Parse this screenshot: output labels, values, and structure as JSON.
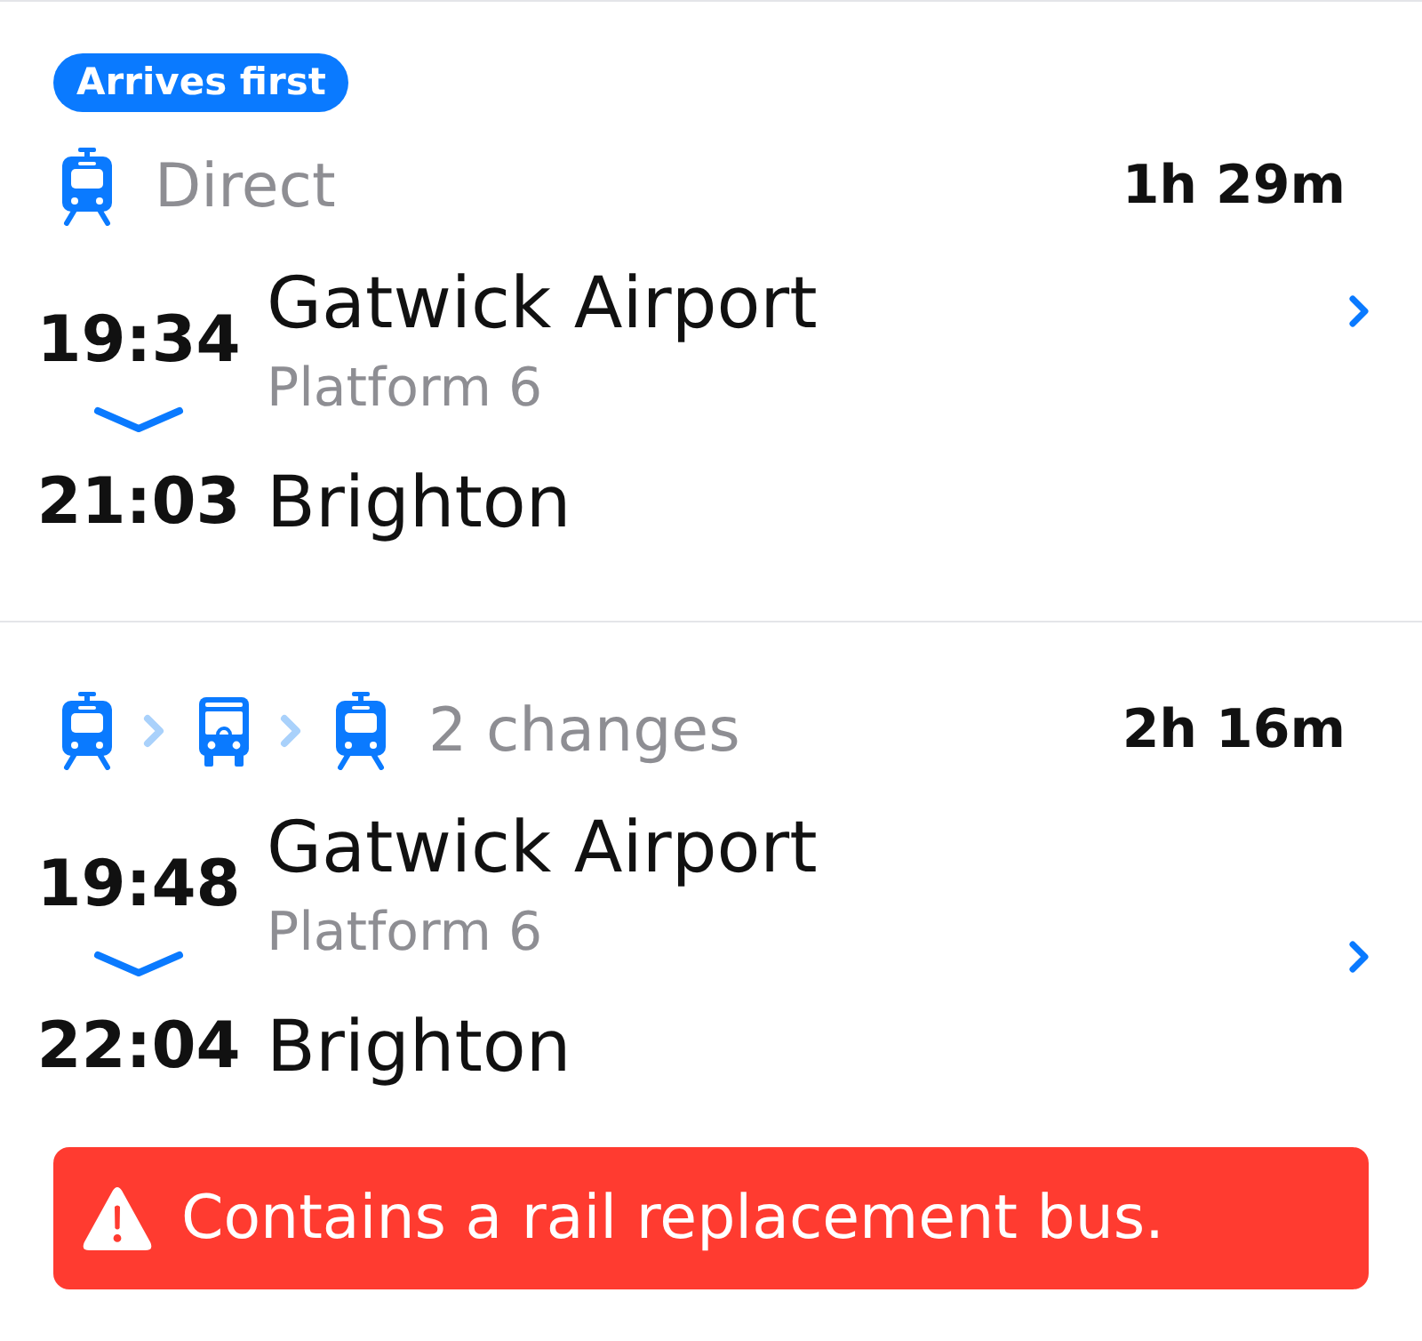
{
  "journeys": [
    {
      "badge": "Arrives first",
      "modes": [
        {
          "kind": "train"
        }
      ],
      "summary": "Direct",
      "duration": "1h 29m",
      "departure": {
        "time": "19:34",
        "station": "Gatwick Airport",
        "platform": "Platform 6"
      },
      "arrival": {
        "time": "21:03",
        "station": "Brighton"
      }
    },
    {
      "modes": [
        {
          "kind": "train"
        },
        {
          "kind": "bus"
        },
        {
          "kind": "train"
        }
      ],
      "summary": "2 changes",
      "duration": "2h 16m",
      "departure": {
        "time": "19:48",
        "station": "Gatwick Airport",
        "platform": "Platform 6"
      },
      "arrival": {
        "time": "22:04",
        "station": "Brighton"
      },
      "alert": "Contains a rail replacement bus."
    }
  ]
}
